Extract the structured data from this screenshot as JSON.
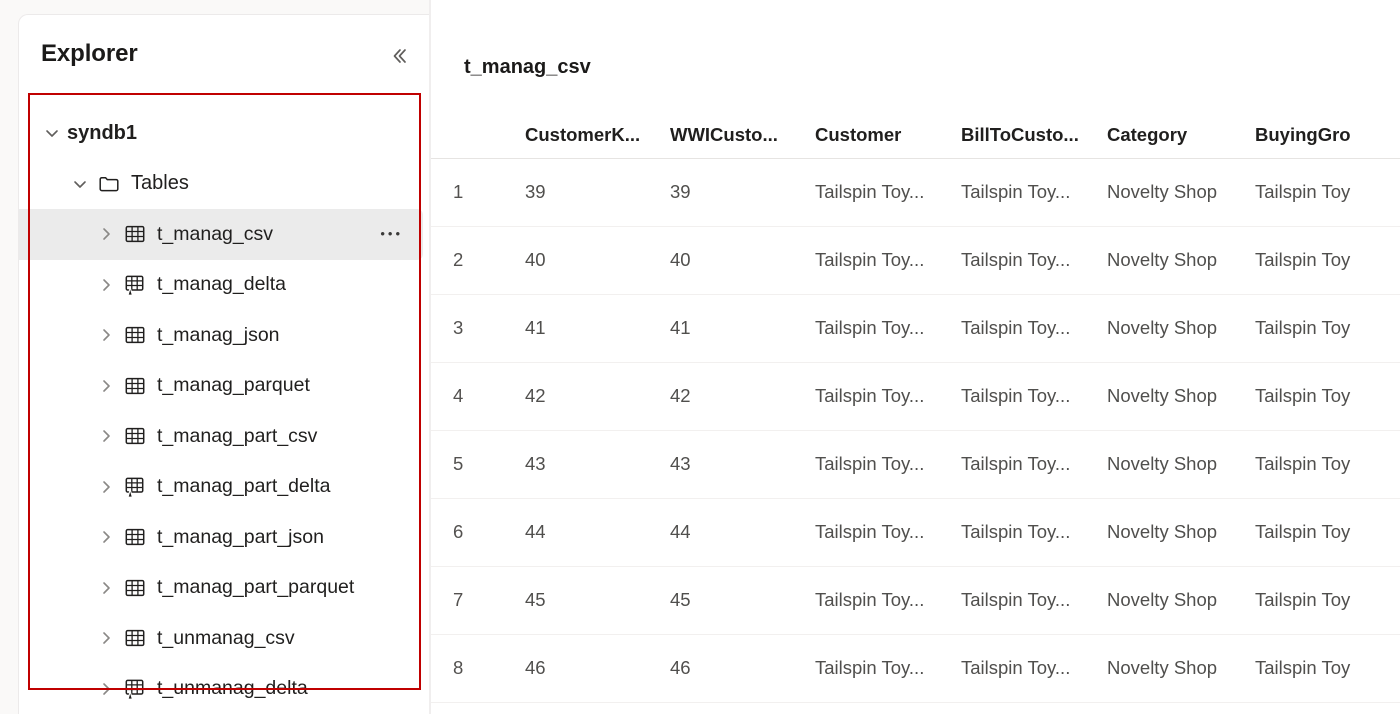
{
  "explorer": {
    "title": "Explorer",
    "collapse_icon": "double-chevron-left-icon",
    "tree": [
      {
        "label": "syndb1",
        "level": "db",
        "icon": "none",
        "expanded": true,
        "twisty": "chevron-down-icon",
        "selected": false,
        "has_ellipsis": false
      },
      {
        "label": "Tables",
        "level": "folder",
        "icon": "folder-icon",
        "expanded": true,
        "twisty": "chevron-down-icon",
        "selected": false,
        "has_ellipsis": false
      },
      {
        "label": "t_manag_csv",
        "level": "table",
        "icon": "table-icon",
        "expanded": false,
        "twisty": "chevron-right-icon",
        "selected": true,
        "has_ellipsis": true
      },
      {
        "label": "t_manag_delta",
        "level": "table",
        "icon": "delta-table-icon",
        "expanded": false,
        "twisty": "chevron-right-icon",
        "selected": false,
        "has_ellipsis": false
      },
      {
        "label": "t_manag_json",
        "level": "table",
        "icon": "table-icon",
        "expanded": false,
        "twisty": "chevron-right-icon",
        "selected": false,
        "has_ellipsis": false
      },
      {
        "label": "t_manag_parquet",
        "level": "table",
        "icon": "table-icon",
        "expanded": false,
        "twisty": "chevron-right-icon",
        "selected": false,
        "has_ellipsis": false
      },
      {
        "label": "t_manag_part_csv",
        "level": "table",
        "icon": "table-icon",
        "expanded": false,
        "twisty": "chevron-right-icon",
        "selected": false,
        "has_ellipsis": false
      },
      {
        "label": "t_manag_part_delta",
        "level": "table",
        "icon": "delta-table-icon",
        "expanded": false,
        "twisty": "chevron-right-icon",
        "selected": false,
        "has_ellipsis": false
      },
      {
        "label": "t_manag_part_json",
        "level": "table",
        "icon": "table-icon",
        "expanded": false,
        "twisty": "chevron-right-icon",
        "selected": false,
        "has_ellipsis": false
      },
      {
        "label": "t_manag_part_parquet",
        "level": "table",
        "icon": "table-icon",
        "expanded": false,
        "twisty": "chevron-right-icon",
        "selected": false,
        "has_ellipsis": false
      },
      {
        "label": "t_unmanag_csv",
        "level": "table",
        "icon": "table-icon",
        "expanded": false,
        "twisty": "chevron-right-icon",
        "selected": false,
        "has_ellipsis": false
      },
      {
        "label": "t_unmanag_delta",
        "level": "table",
        "icon": "delta-table-icon",
        "expanded": false,
        "twisty": "chevron-right-icon",
        "selected": false,
        "has_ellipsis": false
      }
    ],
    "annotation_box_color": "#c00000"
  },
  "grid": {
    "title": "t_manag_csv",
    "columns": [
      {
        "key": "rownum",
        "label": ""
      },
      {
        "key": "customer_key",
        "label": "CustomerK..."
      },
      {
        "key": "wwi_customer",
        "label": "WWICusto..."
      },
      {
        "key": "customer",
        "label": "Customer"
      },
      {
        "key": "bill_to_customer",
        "label": "BillToCusto..."
      },
      {
        "key": "category",
        "label": "Category"
      },
      {
        "key": "buying_group",
        "label": "BuyingGro"
      }
    ],
    "rows": [
      {
        "rownum": "1",
        "customer_key": "39",
        "wwi_customer": "39",
        "customer": "Tailspin Toy...",
        "bill_to_customer": "Tailspin Toy...",
        "category": "Novelty Shop",
        "buying_group": "Tailspin Toy"
      },
      {
        "rownum": "2",
        "customer_key": "40",
        "wwi_customer": "40",
        "customer": "Tailspin Toy...",
        "bill_to_customer": "Tailspin Toy...",
        "category": "Novelty Shop",
        "buying_group": "Tailspin Toy"
      },
      {
        "rownum": "3",
        "customer_key": "41",
        "wwi_customer": "41",
        "customer": "Tailspin Toy...",
        "bill_to_customer": "Tailspin Toy...",
        "category": "Novelty Shop",
        "buying_group": "Tailspin Toy"
      },
      {
        "rownum": "4",
        "customer_key": "42",
        "wwi_customer": "42",
        "customer": "Tailspin Toy...",
        "bill_to_customer": "Tailspin Toy...",
        "category": "Novelty Shop",
        "buying_group": "Tailspin Toy"
      },
      {
        "rownum": "5",
        "customer_key": "43",
        "wwi_customer": "43",
        "customer": "Tailspin Toy...",
        "bill_to_customer": "Tailspin Toy...",
        "category": "Novelty Shop",
        "buying_group": "Tailspin Toy"
      },
      {
        "rownum": "6",
        "customer_key": "44",
        "wwi_customer": "44",
        "customer": "Tailspin Toy...",
        "bill_to_customer": "Tailspin Toy...",
        "category": "Novelty Shop",
        "buying_group": "Tailspin Toy"
      },
      {
        "rownum": "7",
        "customer_key": "45",
        "wwi_customer": "45",
        "customer": "Tailspin Toy...",
        "bill_to_customer": "Tailspin Toy...",
        "category": "Novelty Shop",
        "buying_group": "Tailspin Toy"
      },
      {
        "rownum": "8",
        "customer_key": "46",
        "wwi_customer": "46",
        "customer": "Tailspin Toy...",
        "bill_to_customer": "Tailspin Toy...",
        "category": "Novelty Shop",
        "buying_group": "Tailspin Toy"
      }
    ]
  }
}
